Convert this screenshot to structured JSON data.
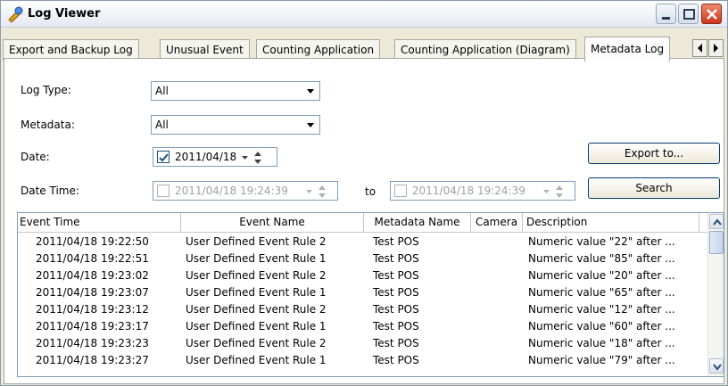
{
  "window": {
    "title": "Log Viewer"
  },
  "tabs": [
    "Export and Backup Log",
    "Unusual Event",
    "Counting Application",
    "Counting Application (Diagram)",
    "Metadata Log"
  ],
  "form": {
    "log_type_label": "Log Type:",
    "log_type_value": "All",
    "metadata_label": "Metadata:",
    "metadata_value": "All",
    "date_label": "Date:",
    "date_value": "2011/04/18",
    "date_time_label": "Date Time:",
    "date_time_from": "2011/04/18 19:24:39",
    "to_label": "to",
    "date_time_to": "2011/04/18 19:24:39",
    "export_button": "Export to...",
    "search_button": "Search"
  },
  "table": {
    "columns": [
      "Event Time",
      "Event Name",
      "Metadata Name",
      "Camera",
      "Description"
    ],
    "rows": [
      [
        "2011/04/18 19:22:50",
        "User Defined Event Rule 2",
        "Test POS",
        "",
        "Numeric value \"22\" after ..."
      ],
      [
        "2011/04/18 19:22:51",
        "User Defined Event Rule 1",
        "Test POS",
        "",
        "Numeric value \"85\" after ..."
      ],
      [
        "2011/04/18 19:23:02",
        "User Defined Event Rule 2",
        "Test POS",
        "",
        "Numeric value \"20\" after ..."
      ],
      [
        "2011/04/18 19:23:07",
        "User Defined Event Rule 1",
        "Test POS",
        "",
        "Numeric value \"65\" after ..."
      ],
      [
        "2011/04/18 19:23:12",
        "User Defined Event Rule 2",
        "Test POS",
        "",
        "Numeric value \"12\" after ..."
      ],
      [
        "2011/04/18 19:23:17",
        "User Defined Event Rule 1",
        "Test POS",
        "",
        "Numeric value \"60\" after ..."
      ],
      [
        "2011/04/18 19:23:23",
        "User Defined Event Rule 2",
        "Test POS",
        "",
        "Numeric value \"18\" after ..."
      ],
      [
        "2011/04/18 19:23:27",
        "User Defined Event Rule 1",
        "Test POS",
        "",
        "Numeric value \"79\" after ..."
      ]
    ]
  },
  "colors": {
    "accent": "#003c74",
    "window_bg": "#ece9d8",
    "close_button": "#c9361b"
  },
  "icons": {
    "title": "log-viewer-icon",
    "dropdown": "chevron-down-icon",
    "spinner": "spinner-icon",
    "checkbox": "check-icon",
    "scroll": "scroll-arrow-icon"
  }
}
